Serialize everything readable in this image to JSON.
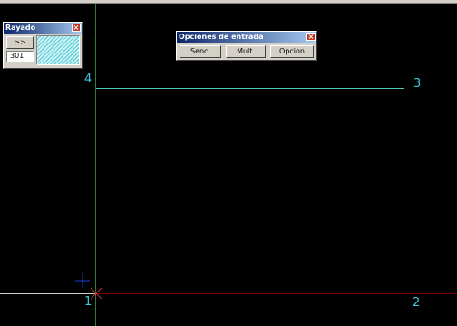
{
  "rayado": {
    "title": "Rayado",
    "close_glyph": "×",
    "next_label": ">>",
    "pattern_code": "301"
  },
  "entry_options": {
    "title": "Opciones de entrada",
    "close_glyph": "×",
    "buttons": [
      {
        "label": "Senc."
      },
      {
        "label": "Mult."
      },
      {
        "label": "Opcion"
      }
    ]
  },
  "vertices": [
    "1",
    "2",
    "3",
    "4"
  ],
  "colors": {
    "rectangle": "#4fc7bf",
    "vertex_label": "#40c8d8",
    "axis_y": "#2e7d32",
    "axis_x": "#7a0000",
    "crosshair": "#1c3fd6"
  },
  "icons": [
    "crosshair-cursor-icon",
    "origin-marker-icon",
    "close-icon"
  ]
}
